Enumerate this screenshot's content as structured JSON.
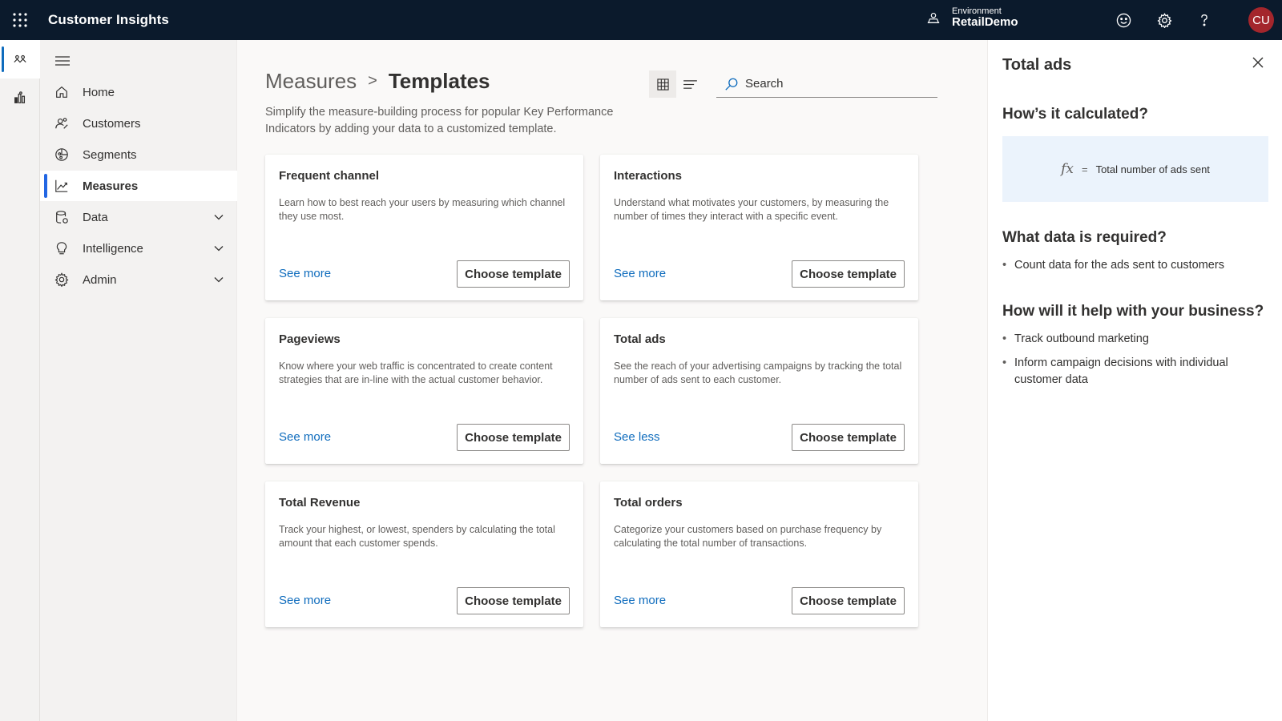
{
  "topbar": {
    "app_title": "Customer Insights",
    "environment_label": "Environment",
    "environment_value": "RetailDemo",
    "avatar_initials": "CU",
    "avatar_color": "#a4262c"
  },
  "nav": {
    "items": [
      {
        "label": "Home",
        "icon": "home-icon"
      },
      {
        "label": "Customers",
        "icon": "customers-icon"
      },
      {
        "label": "Segments",
        "icon": "segments-icon"
      },
      {
        "label": "Measures",
        "icon": "measures-icon",
        "active": true
      },
      {
        "label": "Data",
        "icon": "data-icon",
        "expandable": true
      },
      {
        "label": "Intelligence",
        "icon": "intelligence-icon",
        "expandable": true
      },
      {
        "label": "Admin",
        "icon": "admin-icon",
        "expandable": true
      }
    ]
  },
  "main": {
    "breadcrumb_parent": "Measures",
    "breadcrumb_separator": ">",
    "breadcrumb_current": "Templates",
    "search_placeholder": "Search",
    "description": "Simplify the measure-building process for popular Key Performance Indicators by adding your data to a customized template.",
    "cards": [
      {
        "title": "Frequent channel",
        "desc": "Learn how to best reach your users by measuring which channel they use most.",
        "link": "See more",
        "button": "Choose template"
      },
      {
        "title": "Interactions",
        "desc": "Understand what motivates your customers, by measuring the number of times they interact with a specific event.",
        "link": "See more",
        "button": "Choose template"
      },
      {
        "title": "Pageviews",
        "desc": "Know where your web traffic is concentrated to create content strategies that are in-line with the actual customer behavior.",
        "link": "See more",
        "button": "Choose template"
      },
      {
        "title": "Total ads",
        "desc": "See the reach of your advertising campaigns by tracking the total number of ads sent to each customer.",
        "link": "See less",
        "button": "Choose template"
      },
      {
        "title": "Total Revenue",
        "desc": "Track your highest, or lowest, spenders by calculating the total amount that each customer spends.",
        "link": "See more",
        "button": "Choose template"
      },
      {
        "title": "Total orders",
        "desc": "Categorize your customers based on purchase frequency by calculating the total number of transactions.",
        "link": "See more",
        "button": "Choose template"
      }
    ]
  },
  "panel": {
    "title": "Total ads",
    "calc_heading": "How’s it calculated?",
    "formula_fx": "fx",
    "formula_eq": "=",
    "formula_text": "Total number of ads sent",
    "data_heading": "What data is required?",
    "data_items": [
      "Count data for the ads sent to customers"
    ],
    "help_heading": "How will it help with your business?",
    "help_items": [
      "Track outbound marketing",
      "Inform campaign decisions with individual customer data"
    ]
  },
  "colors": {
    "topbar_bg": "#0b1a2c",
    "accent": "#0f6cbd",
    "nav_active_bar": "#2266e3",
    "formula_bg": "#ebf3fc"
  }
}
